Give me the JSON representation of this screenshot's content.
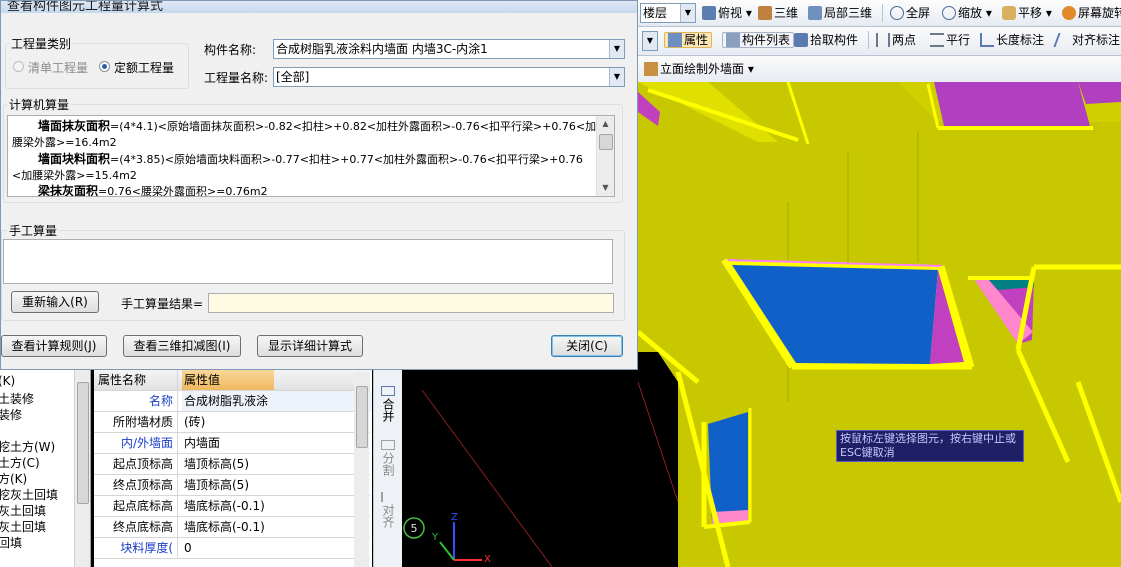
{
  "dialog": {
    "title": "查看构件图元工程量计算式",
    "qty_type_group": "工程量类别",
    "radio_list": "清单工程量",
    "radio_quota": "定额工程量",
    "component_name_label": "构件名称:",
    "component_name_value": "合成树脂乳液涂料内墙面 内墙3C-内涂1",
    "qty_name_label": "工程量名称:",
    "qty_name_value": "[全部]",
    "calc_group": "计算机算量",
    "calc_lines": [
      {
        "bold": "墙面抹灰面积",
        "text": "=(4*4.1)<原始墙面抹灰面积>-0.82<扣柱>+0.82<加柱外露面积>-0.76<扣平行梁>+0.76<加"
      },
      {
        "bold": "",
        "text": "腰梁外露>=16.4m2"
      },
      {
        "bold": "墙面块料面积",
        "text": "=(4*3.85)<原始墙面块料面积>-0.77<扣柱>+0.77<加柱外露面积>-0.76<扣平行梁>+0.76"
      },
      {
        "bold": "",
        "text": "<加腰梁外露>=15.4m2"
      },
      {
        "bold": "梁抹灰面积",
        "text": "=0.76<腰梁外露面积>=0.76m2"
      }
    ],
    "manual_group": "手工算量",
    "reenter_button": "重新输入(R)",
    "manual_result_label": "手工算量结果=",
    "manual_result_value": "",
    "btn_rules": "查看计算规则(J)",
    "btn_3d": "查看三维扣减图(I)",
    "btn_detail": "显示详细计算式",
    "btn_close": "关闭(C)"
  },
  "toolbar": {
    "floor": "楼层",
    "view": "俯视",
    "three_d": "三维",
    "local_3d": "局部三维",
    "fullscreen": "全屏",
    "zoom": "缩放",
    "pan": "平移",
    "rotate": "屏幕旋转",
    "properties": "属性",
    "component_list": "构件列表",
    "pick_component": "拾取构件",
    "two_points": "两点",
    "parallel": "平行",
    "length_dim": "长度标注",
    "aligned_dim": "对齐标注",
    "elevation_draw": "立面绘制外墙面"
  },
  "viewport": {
    "hint": "按鼠标左键选择图元，按右键中止或ESC键取消",
    "step_badge": "5",
    "colors": {
      "wall": "#c8c800",
      "edge": "#ffff00",
      "panel_blue": "#1060c8",
      "panel_magenta": "#c040c0"
    }
  },
  "left_tree": [
    "(K)",
    "土装修",
    "装修",
    "",
    "挖土方(W)",
    "土方(C)",
    "方(K)",
    "挖灰土回填",
    "灰土回填",
    "灰土回填",
    "回填"
  ],
  "property_grid": {
    "header_name": "属性名称",
    "header_value": "属性值",
    "rows": [
      {
        "name": "名称",
        "value": "合成树脂乳液涂",
        "blue": true
      },
      {
        "name": "所附墙材质",
        "value": "(砖)",
        "blue": false
      },
      {
        "name": "内/外墙面",
        "value": "内墙面",
        "blue": true
      },
      {
        "name": "起点顶标高",
        "value": "墙顶标高(5)",
        "blue": false
      },
      {
        "name": "终点顶标高",
        "value": "墙顶标高(5)",
        "blue": false
      },
      {
        "name": "起点底标高",
        "value": "墙底标高(-0.1)",
        "blue": false
      },
      {
        "name": "终点底标高",
        "value": "墙底标高(-0.1)",
        "blue": false
      },
      {
        "name": "块料厚度(",
        "value": "0",
        "blue": true
      }
    ]
  },
  "side_tools": {
    "merge": "合并",
    "split": "分割",
    "align": "对齐"
  }
}
